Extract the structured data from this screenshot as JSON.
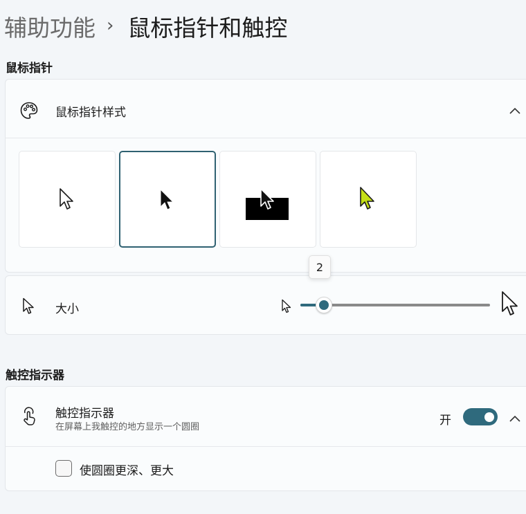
{
  "breadcrumb": {
    "parent": "辅助功能",
    "separator": "›",
    "current": "鼠标指针和触控"
  },
  "mouse_pointer": {
    "heading": "鼠标指针",
    "style_row": {
      "label": "鼠标指针样式",
      "icon": "palette-icon"
    },
    "styles": [
      {
        "name": "white",
        "selected": false
      },
      {
        "name": "black",
        "selected": true
      },
      {
        "name": "inverted",
        "selected": false
      },
      {
        "name": "custom",
        "selected": false,
        "color": "#c5e017"
      }
    ],
    "size": {
      "label": "大小",
      "value": "2",
      "value_num": 2,
      "min": 1,
      "max": 15,
      "icon": "pointer-icon"
    }
  },
  "touch": {
    "heading": "触控指示器",
    "indicator": {
      "title": "触控指示器",
      "subtitle": "在屏幕上我触控的地方显示一个圆圈",
      "toggle_label": "开",
      "toggle_on": true,
      "icon": "touch-icon"
    },
    "darker_circle": {
      "label": "使圆圈更深、更大",
      "checked": false
    }
  },
  "colors": {
    "accent": "#2f6a7d",
    "track": "#8a8a8a",
    "custom_pointer": "#c5e017"
  }
}
